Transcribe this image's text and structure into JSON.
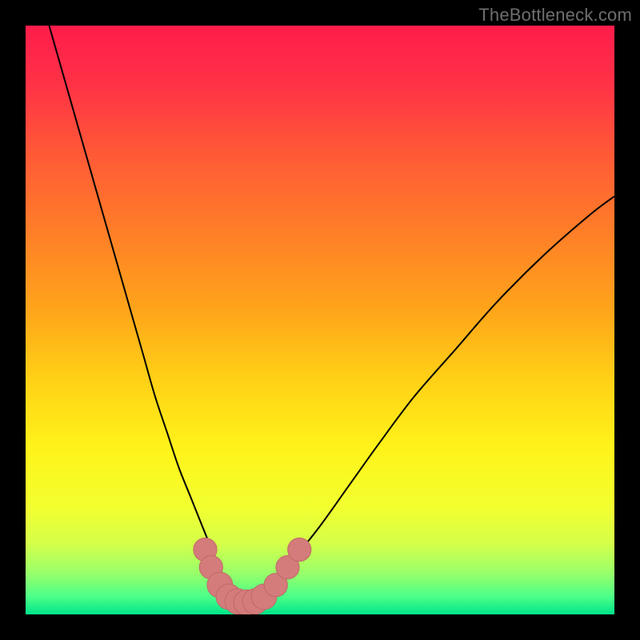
{
  "watermark": "TheBottleneck.com",
  "colors": {
    "background": "#000000",
    "curve": "#000000",
    "marker_fill": "#d47b7b",
    "marker_stroke": "#c06868"
  },
  "gradient_stops": [
    {
      "offset": 0.0,
      "color": "#ff1c4b"
    },
    {
      "offset": 0.1,
      "color": "#ff3246"
    },
    {
      "offset": 0.22,
      "color": "#ff5a36"
    },
    {
      "offset": 0.35,
      "color": "#ff7e28"
    },
    {
      "offset": 0.48,
      "color": "#ffa41a"
    },
    {
      "offset": 0.6,
      "color": "#ffd016"
    },
    {
      "offset": 0.72,
      "color": "#fff41a"
    },
    {
      "offset": 0.82,
      "color": "#f2ff30"
    },
    {
      "offset": 0.88,
      "color": "#d4ff4a"
    },
    {
      "offset": 0.93,
      "color": "#98ff6a"
    },
    {
      "offset": 0.97,
      "color": "#4cff88"
    },
    {
      "offset": 1.0,
      "color": "#00e58a"
    }
  ],
  "chart_data": {
    "type": "line",
    "title": "",
    "xlabel": "",
    "ylabel": "",
    "xlim": [
      0,
      100
    ],
    "ylim": [
      0,
      100
    ],
    "series": [
      {
        "name": "curve",
        "x": [
          4,
          6,
          8,
          10,
          12,
          14,
          16,
          18,
          20,
          22,
          24,
          26,
          28,
          30,
          32,
          33,
          34,
          35,
          36,
          37,
          38,
          39,
          41,
          43,
          46,
          50,
          55,
          60,
          66,
          73,
          80,
          88,
          96,
          100
        ],
        "y": [
          100,
          93,
          86,
          79,
          72,
          65,
          58,
          51,
          44,
          37,
          31,
          25,
          20,
          15,
          10,
          7,
          5,
          3.5,
          2.5,
          2,
          2,
          2.5,
          4,
          6.5,
          10,
          15,
          22,
          29,
          37,
          45,
          53,
          61,
          68,
          71
        ]
      }
    ],
    "markers": [
      {
        "x": 30.5,
        "y": 11.0,
        "r": 1.6
      },
      {
        "x": 31.5,
        "y": 8.0,
        "r": 1.6
      },
      {
        "x": 33.0,
        "y": 5.0,
        "r": 1.8
      },
      {
        "x": 34.5,
        "y": 3.0,
        "r": 1.8
      },
      {
        "x": 36.0,
        "y": 2.2,
        "r": 1.8
      },
      {
        "x": 37.5,
        "y": 2.0,
        "r": 1.8
      },
      {
        "x": 39.0,
        "y": 2.2,
        "r": 1.8
      },
      {
        "x": 40.5,
        "y": 3.0,
        "r": 1.8
      },
      {
        "x": 42.5,
        "y": 5.0,
        "r": 1.6
      },
      {
        "x": 44.5,
        "y": 8.0,
        "r": 1.6
      },
      {
        "x": 46.5,
        "y": 11.0,
        "r": 1.6
      }
    ]
  }
}
